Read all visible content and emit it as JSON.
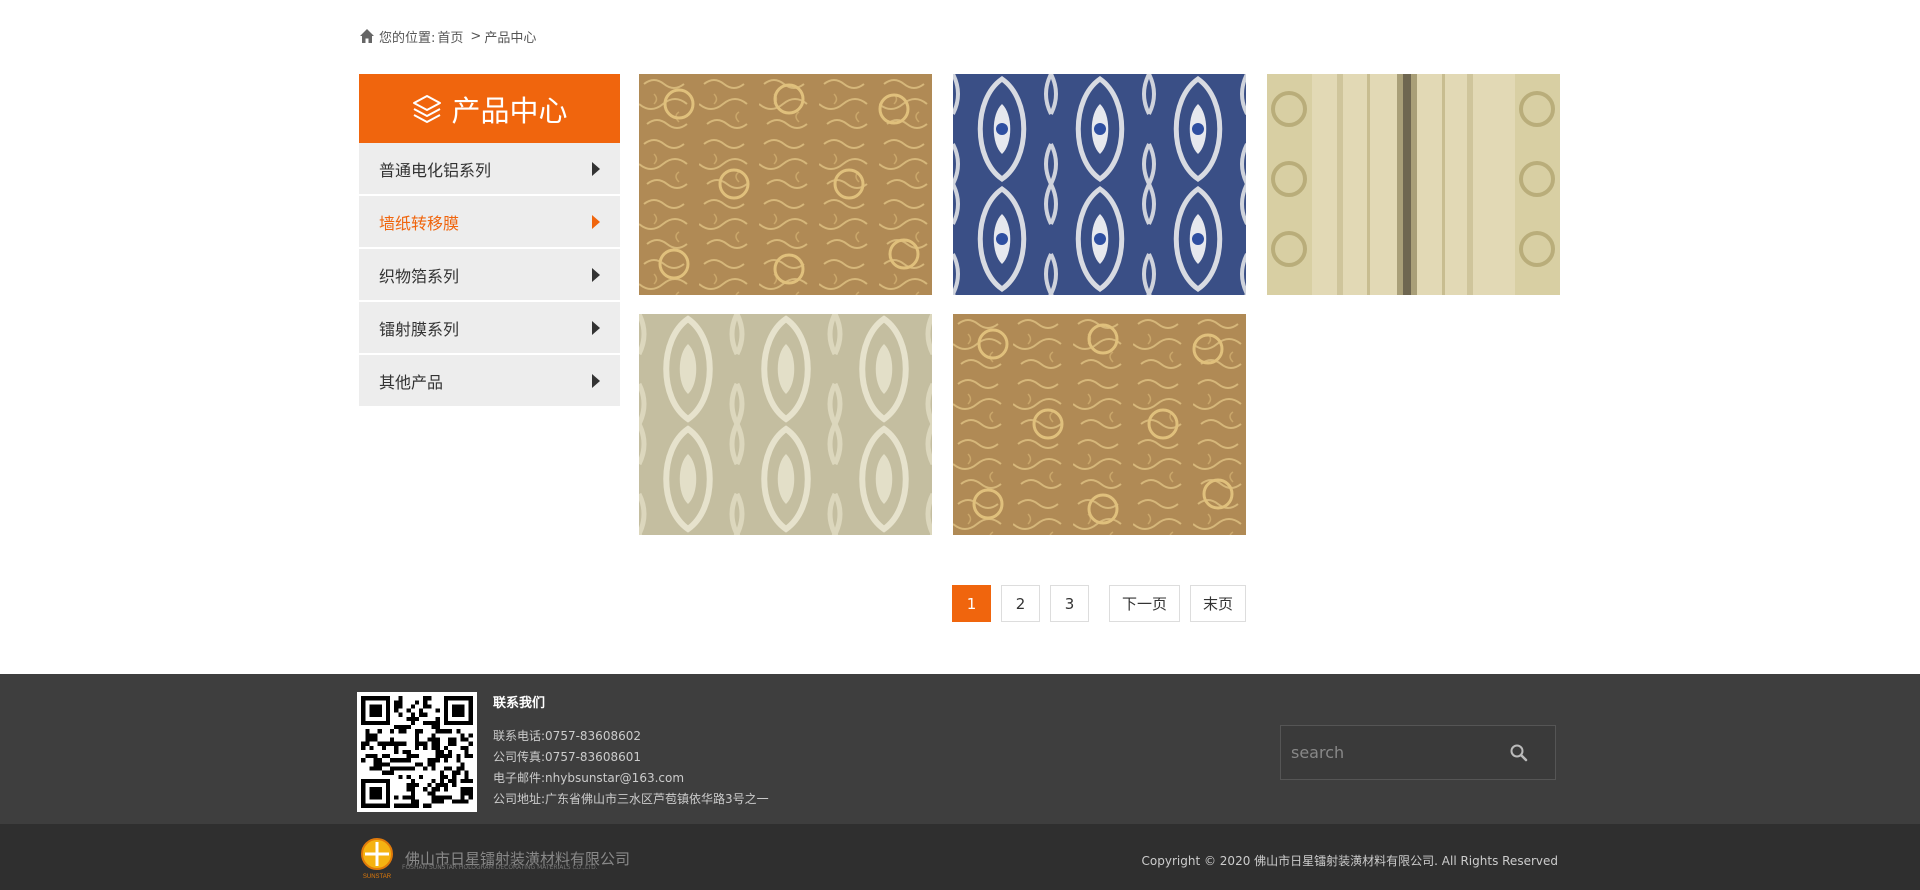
{
  "breadcrumb": {
    "prefix": "您的位置:",
    "home": "首页",
    "separator": ">",
    "current": "产品中心"
  },
  "sidebar": {
    "title": "产品中心",
    "items": [
      {
        "label": "普通电化铝系列",
        "active": false
      },
      {
        "label": "墙纸转移膜",
        "active": true
      },
      {
        "label": "织物箔系列",
        "active": false
      },
      {
        "label": "镭射膜系列",
        "active": false
      },
      {
        "label": "其他产品",
        "active": false
      }
    ]
  },
  "products": [
    {
      "pattern": "gold-swirl"
    },
    {
      "pattern": "blue-damask"
    },
    {
      "pattern": "stripe-cream"
    },
    {
      "pattern": "cream-damask"
    },
    {
      "pattern": "gold-swirl"
    }
  ],
  "pagination": {
    "pages": [
      "1",
      "2",
      "3"
    ],
    "current": "1",
    "next": "下一页",
    "last": "末页"
  },
  "footer": {
    "contact_title": "联系我们",
    "phone": "联系电话:0757-83608602",
    "fax": "公司传真:0757-83608601",
    "email": "电子邮件:nhybsunstar@163.com",
    "address": "公司地址:广东省佛山市三水区芦苞镇依华路3号之一",
    "search_placeholder": "search",
    "company_name": "佛山市日星镭射装潢材料有限公司",
    "company_en": "FOSHAN SUNSTAR HOLOGRAM DECORATING MATERIALS CO.,LTD.",
    "logo_text": "SUNSTAR",
    "copyright": "Copyright © 2020 佛山市日星镭射装潢材料有限公司. All Rights Reserved"
  },
  "colors": {
    "accent": "#f0650d",
    "footer_top": "#3e3e3e",
    "footer_bottom": "#2f2f2f"
  }
}
